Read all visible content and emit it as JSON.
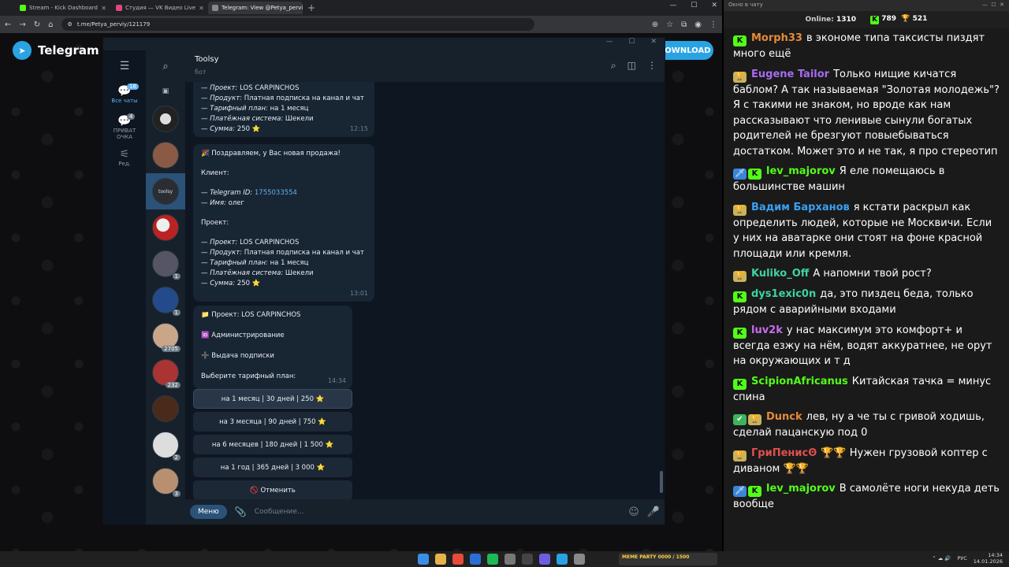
{
  "browser": {
    "tabs": [
      {
        "label": "Stream - Kick Dashboard",
        "color": "#53fc18"
      },
      {
        "label": "Студия — VK Видео Live",
        "color": "#e0457b"
      },
      {
        "label": "Telegram: View @Petya_perviy",
        "color": "#aaaaaa"
      }
    ],
    "url": "t.me/Petya_perviy/121179"
  },
  "tg": {
    "brand": "Telegram",
    "download": "DOWNLOAD",
    "folders": [
      {
        "label": "Все чаты",
        "badge": "16"
      },
      {
        "label": "ПРИВАТ ОЧКА",
        "badge": "4"
      },
      {
        "label": "Ред."
      }
    ],
    "chat_counts": [
      "1",
      "1",
      "2705",
      "232",
      "2",
      "3"
    ],
    "chat": {
      "title": "Toolsy",
      "subtitle": "бот"
    },
    "msg1": {
      "lines": [
        {
          "k": "Проект:",
          "v": "LOS CARPINCHOS"
        },
        {
          "k": "Продукт:",
          "v": "Платная подписка на канал и чат"
        },
        {
          "k": "Тарифный план:",
          "v": "на 1 месяц"
        },
        {
          "k": "Платёжная система:",
          "v": "Шекели"
        },
        {
          "k": "Сумма:",
          "v": "250 ⭐"
        }
      ],
      "time": "12:15"
    },
    "msg2": {
      "heading": "🎉 Поздравляем, у Вас новая продажа!",
      "client": "Клиент:",
      "tg_id_label": "Telegram ID:",
      "tg_id": "1755033554",
      "name_label": "Имя:",
      "name": "олег",
      "project": "Проект:",
      "lines": [
        {
          "k": "Проект:",
          "v": "LOS CARPINCHOS"
        },
        {
          "k": "Продукт:",
          "v": "Платная подписка на канал и чат"
        },
        {
          "k": "Тарифный план:",
          "v": "на 1 месяц"
        },
        {
          "k": "Платёжная система:",
          "v": "Шекели"
        },
        {
          "k": "Сумма:",
          "v": "250 ⭐"
        }
      ],
      "time": "13:01"
    },
    "msg3": {
      "project": "📁 Проект: LOS CARPINCHOS",
      "admin": "🆔 Администрирование",
      "issue": "➕ Выдача подписки",
      "choose": "Выберите тарифный план:",
      "time": "14:34"
    },
    "buttons": [
      "на 1 месяц | 30 дней | 250 ⭐",
      "на 3 месяца | 90 дней | 750 ⭐",
      "на 6 месяцев | 180 дней | 1 500 ⭐",
      "на 1 год | 365 дней | 3 000 ⭐",
      "🚫 Отменить"
    ],
    "composer": {
      "menu": "Меню",
      "placeholder": "Сообщение..."
    }
  },
  "chat_panel": {
    "title": "Окно в чату",
    "online_label": "Online:",
    "online": "1310",
    "k_count": "789",
    "g_count": "521",
    "messages": [
      {
        "user": "Morph33",
        "color": "#e58a3a",
        "badges": [
          "k"
        ],
        "text": "в экономе типа таксисты пиздят много ещё"
      },
      {
        "user": "Eugene Tailor",
        "color": "#a66cf0",
        "badges": [
          "g"
        ],
        "text": "Только нищие кичатся баблом? А так называемая \"Золотая молодежь\"? Я с такими не знаком, но вроде как нам рассказывают что ленивые сынули богатых родителей не брезгуют повыебываться достатком. Может это и не так, я про стереотип"
      },
      {
        "user": "lev_majorov",
        "color": "#53fc18",
        "badges": [
          "m",
          "k"
        ],
        "text": "Я еле помещаюсь в большинстве машин"
      },
      {
        "user": "Вадим Барханов",
        "color": "#3aa0f0",
        "badges": [
          "g"
        ],
        "text": "я кстати раскрыл как определить людей, которые не Москвичи. Если у них на аватарке они стоят на фоне красной площади или кремля."
      },
      {
        "user": "Kuliko_Off",
        "color": "#3fd2a0",
        "badges": [
          "g"
        ],
        "text": "А напомни твой рост?"
      },
      {
        "user": "dys1exic0n",
        "color": "#3fd2a0",
        "badges": [
          "k"
        ],
        "text": "да, это пиздец беда, только рядом с аварийными входами"
      },
      {
        "user": "luv2k",
        "color": "#c86cf0",
        "badges": [
          "k"
        ],
        "text": "у нас максимум это комфорт+ и всегда езжу на нём, водят аккуратнее, не орут на окружающих и т д"
      },
      {
        "user": "ScipionAfricanus",
        "color": "#53fc18",
        "badges": [
          "k"
        ],
        "text": "Китайская тачка = минус спина"
      },
      {
        "user": "Dunck",
        "color": "#e58a3a",
        "badges": [
          "c",
          "g"
        ],
        "text": "лев, ну а че ты с гривой ходишь, сделай пацанскую под 0"
      },
      {
        "user": "ГриПенисꙨ",
        "color": "#e05050",
        "badges": [
          "g"
        ],
        "text": "🏆🏆 Нужен грузовой коптер с диваном 🏆🏆"
      },
      {
        "user": "lev_majorov",
        "color": "#53fc18",
        "badges": [
          "m",
          "k"
        ],
        "text": "В самолёте ноги некуда деть вообще"
      }
    ]
  },
  "taskbar": {
    "meme": "MEME PARTY 0000 / 1500",
    "lang": "РУС",
    "time": "14:34",
    "date": "14.01.2026"
  }
}
